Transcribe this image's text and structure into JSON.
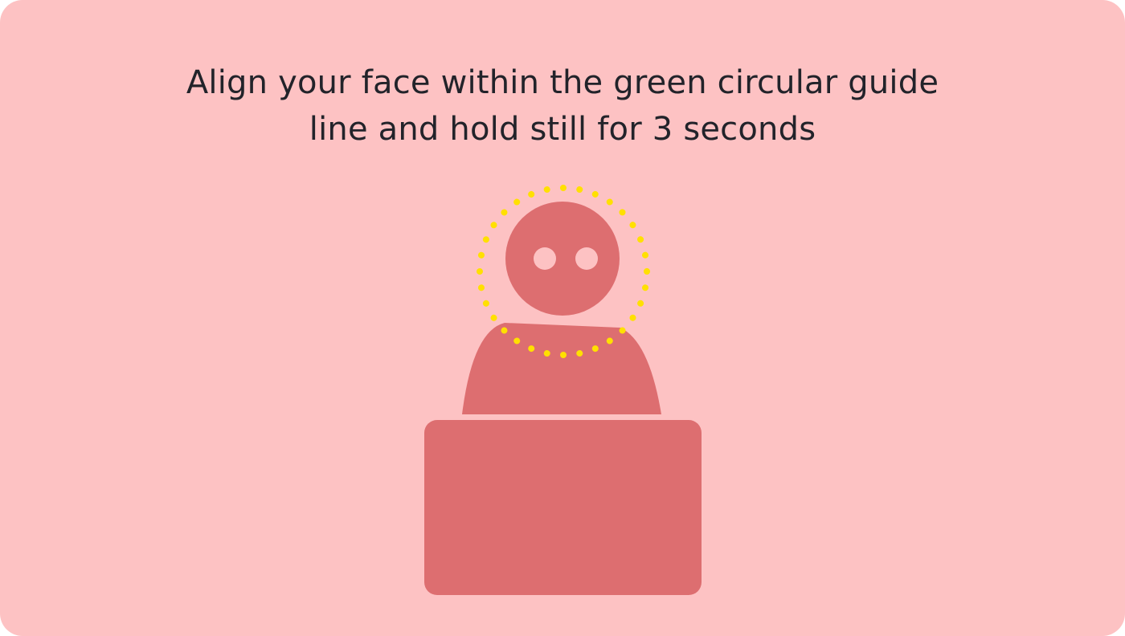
{
  "instruction": {
    "line1": "Align your face within the green circular guide",
    "line2": "line and hold still for 3 seconds"
  },
  "colors": {
    "background": "#fdc2c3",
    "figure": "#dd6e70",
    "guide_dots": "#ffe000",
    "eyes": "#fdc2c3",
    "text": "#22232a"
  },
  "illustration": {
    "figure": "person-at-laptop",
    "guide": "dotted-circle"
  }
}
